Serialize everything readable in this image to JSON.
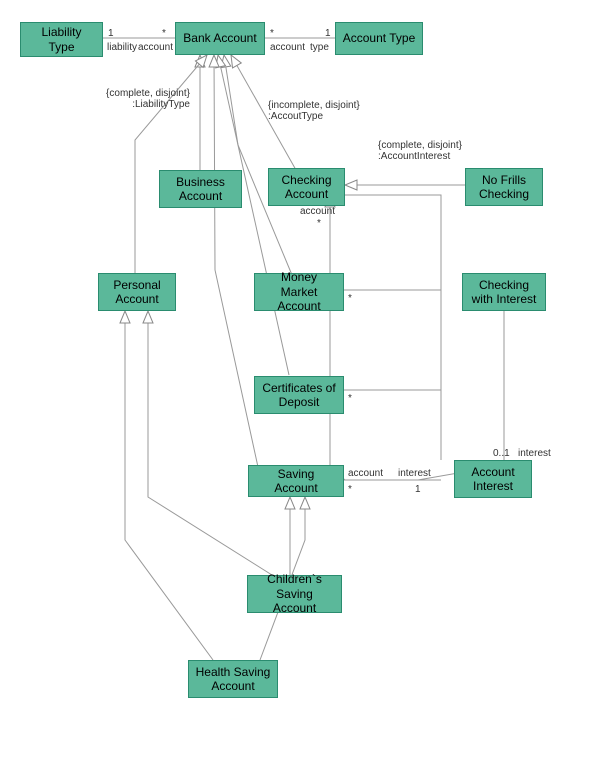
{
  "classes": {
    "liabilityType": "Liability\nType",
    "bankAccount": "Bank Account",
    "accountType": "Account Type",
    "businessAccount": "Business\nAccount",
    "checkingAccount": "Checking\nAccount",
    "noFrillsChecking": "No Frills\nChecking",
    "personalAccount": "Personal\nAccount",
    "moneyMarketAccount": "Money Market\nAccount",
    "checkingWithInterest": "Checking with\nInterest",
    "certificatesOfDeposit": "Certificates of\nDeposit",
    "savingAccount": "Saving Account",
    "accountInterest": "Account\nInterest",
    "childrensSavingAccount": "Children`s\nSaving Account",
    "healthSavingAccount": "Health Saving\nAccount"
  },
  "labels": {
    "liability_account_1": "1",
    "liability_account_star": "*",
    "liability_role": "liability",
    "account_role1": "account",
    "account_role2": "account",
    "type_role": "type",
    "account_type_star": "*",
    "account_type_1": "1",
    "gs_liability": "{complete, disjoint}\n:LiabilityType",
    "gs_accountType": "{incomplete, disjoint}\n:AccoutType",
    "gs_accountInterest": "{complete, disjoint}\n:AccountInterest",
    "checking_account_role": "account",
    "checking_star": "*",
    "mm_star": "*",
    "cod_star": "*",
    "saving_account_role": "account",
    "saving_star": "*",
    "interest_role": "interest",
    "interest_1": "1",
    "interest_01": "0..1",
    "interest_col": "interest"
  }
}
